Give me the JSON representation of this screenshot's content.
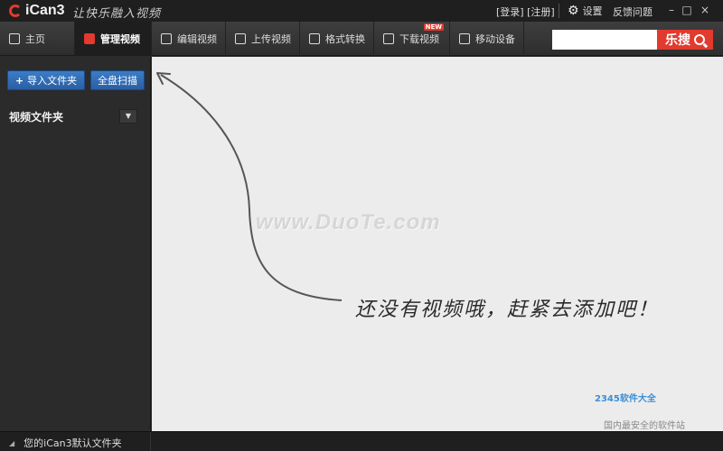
{
  "app": {
    "logo_text": "iCan3",
    "slogan": "让快乐融入视频",
    "login_text": "[登录] [注册]",
    "settings_label": "设置",
    "feedback_label": "反馈问题"
  },
  "window_controls": {
    "minimize": "–",
    "maximize": "□",
    "close": "×"
  },
  "tabs": [
    {
      "label": "主页"
    },
    {
      "label": "管理视频"
    },
    {
      "label": "编辑视频"
    },
    {
      "label": "上传视频"
    },
    {
      "label": "格式转换"
    },
    {
      "label": "下载视频",
      "badge": "NEW"
    },
    {
      "label": "移动设备"
    }
  ],
  "search": {
    "placeholder": "",
    "button_label": "乐搜"
  },
  "sidebar": {
    "import_label": "导入文件夹",
    "scan_label": "全盘扫描",
    "folder_label": "视频文件夹"
  },
  "main": {
    "watermark": "www.DuoTe.com",
    "empty_message": "还没有视频哦，赶紧去添加吧！",
    "corner_logo": "2345软件大全",
    "corner_sub": "国内最安全的软件站"
  },
  "status": {
    "default_folder": "您的iCan3默认文件夹"
  },
  "colors": {
    "accent_red": "#e23a2e",
    "button_blue": "#2a5fa3"
  }
}
